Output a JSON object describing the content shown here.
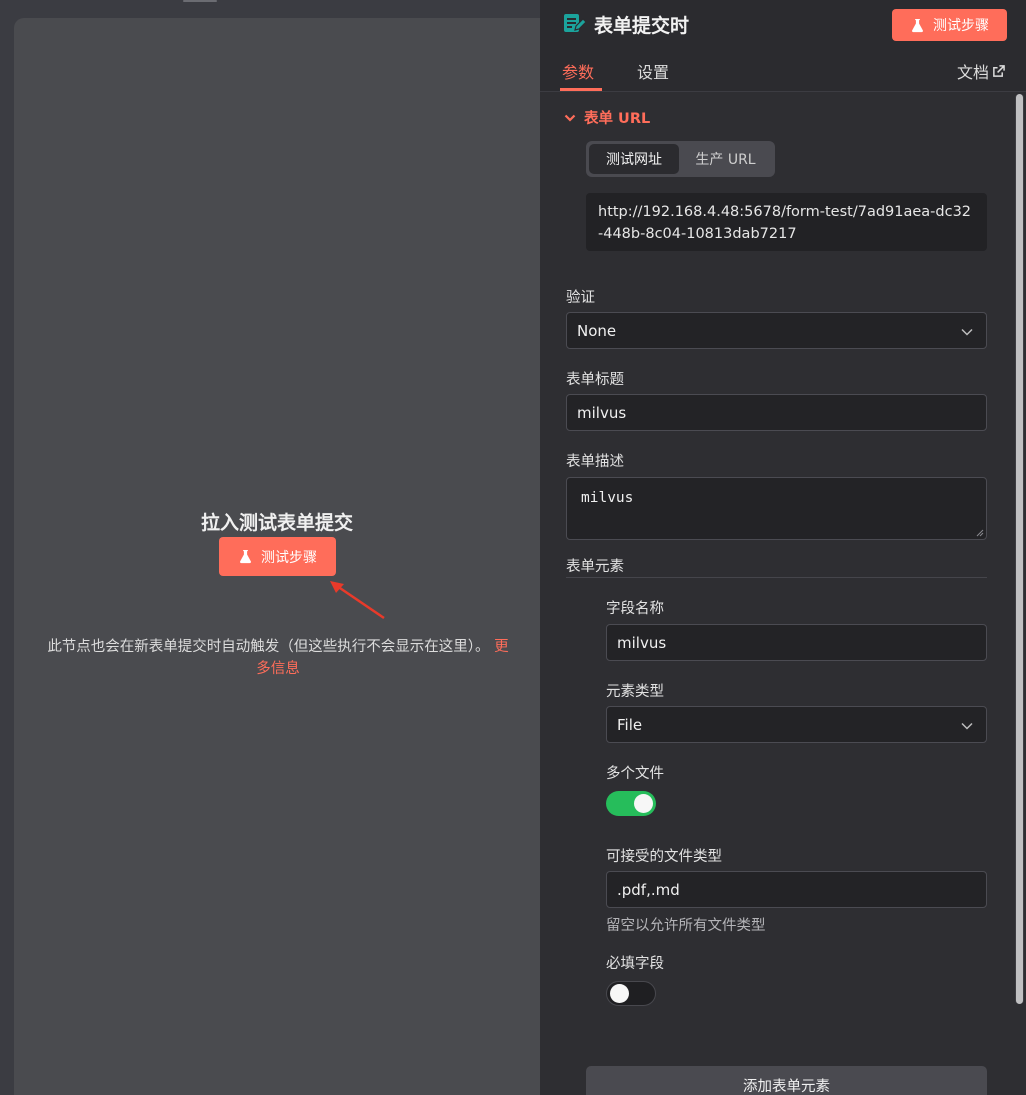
{
  "canvas": {
    "title": "拉入测试表单提交",
    "test_button_label": "测试步骤",
    "note": "此节点也会在新表单提交时自动触发（但这些执行不会显示在这里）。",
    "note_link_1": "更",
    "note_link_2": "多信息"
  },
  "panel": {
    "title": "表单提交时",
    "test_button_label": "测试步骤",
    "tabs": {
      "params": "参数",
      "settings": "设置",
      "docs": "文档"
    },
    "form_url": {
      "section_label": "表单 URL",
      "segments": [
        "测试网址",
        "生产 URL"
      ],
      "url": "http://192.168.4.48:5678/form-test/7ad91aea-dc32-448b-8c04-10813dab7217"
    },
    "auth": {
      "label": "验证",
      "value": "None"
    },
    "form_title": {
      "label": "表单标题",
      "value": "milvus"
    },
    "form_description": {
      "label": "表单描述",
      "value": "milvus"
    },
    "form_elements": {
      "label": "表单元素",
      "field_name_label": "字段名称",
      "field_name_value": "milvus",
      "element_type_label": "元素类型",
      "element_type_value": "File",
      "multiple_files_label": "多个文件",
      "multiple_files_on": true,
      "accepted_types_label": "可接受的文件类型",
      "accepted_types_value": ".pdf,.md",
      "accepted_types_hint": "留空以允许所有文件类型",
      "required_label": "必填字段",
      "required_on": false,
      "add_button_label": "添加表单元素"
    }
  },
  "colors": {
    "accent": "#ff6d5a",
    "toggle_on": "#26bd5b",
    "panel_bg": "#2e2e32",
    "canvas_bg": "#4a4b4f"
  }
}
